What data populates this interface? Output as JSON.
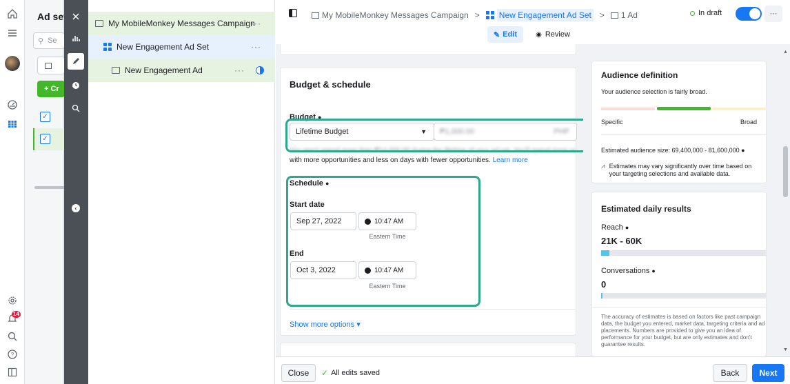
{
  "campaign": {
    "name": "My MobileMonkey Messages Campaign"
  },
  "adset": {
    "name": "New Engagement Ad Set"
  },
  "ad": {
    "name": "New Engagement Ad",
    "breadcrumb": "1 Ad"
  },
  "left": {
    "title": "Ad sets",
    "search_prefix": "Se",
    "create_label": "+ Cr",
    "notification_count": "14"
  },
  "header": {
    "draft_label": "In draft",
    "more": "···",
    "edit_label": "Edit",
    "review_label": "Review",
    "sep": ">"
  },
  "budget": {
    "title": "Budget & schedule",
    "budget_label": "Budget",
    "type_value": "Lifetime Budget",
    "amount_value": "₱1,000.00",
    "amount_currency": "PHP",
    "hint_blurred": "You won't spend more than ₱14,000.00 during the lifetime of your ad set. You'll spend more on days",
    "hint_text": "with more opportunities and less on days with fewer opportunities.",
    "learn_more": "Learn more",
    "schedule_label": "Schedule",
    "start_label": "Start date",
    "start_date": "Sep 27, 2022",
    "start_time": "10:47 AM",
    "end_label": "End",
    "end_date": "Oct 3, 2022",
    "end_time": "10:47 AM",
    "timezone": "Eastern Time",
    "show_more": "Show more options ▾"
  },
  "audience": {
    "title": "Audience definition",
    "desc": "Your audience selection is fairly broad.",
    "specific": "Specific",
    "broad": "Broad",
    "size": "Estimated audience size: 69,400,000 - 81,600,000",
    "note": "Estimates may vary significantly over time based on your targeting selections and available data."
  },
  "daily": {
    "title": "Estimated daily results",
    "reach_label": "Reach",
    "reach_value": "21K - 60K",
    "reach_level": 0.05,
    "conv_label": "Conversations",
    "conv_value": "0",
    "conv_level": 0.01,
    "note": "The accuracy of estimates is based on factors like past campaign data, the budget you entered, market data, targeting criteria and ad placements. Numbers are provided to give you an idea of performance for your budget, but are only estimates and don't guarantee results."
  },
  "footer": {
    "close": "Close",
    "saved": "All edits saved",
    "back": "Back",
    "next": "Next"
  },
  "colors": {
    "accent": "#1877f2",
    "teal": "#2ea88d",
    "tool": "#4b4f56",
    "green": "#42b72a"
  }
}
